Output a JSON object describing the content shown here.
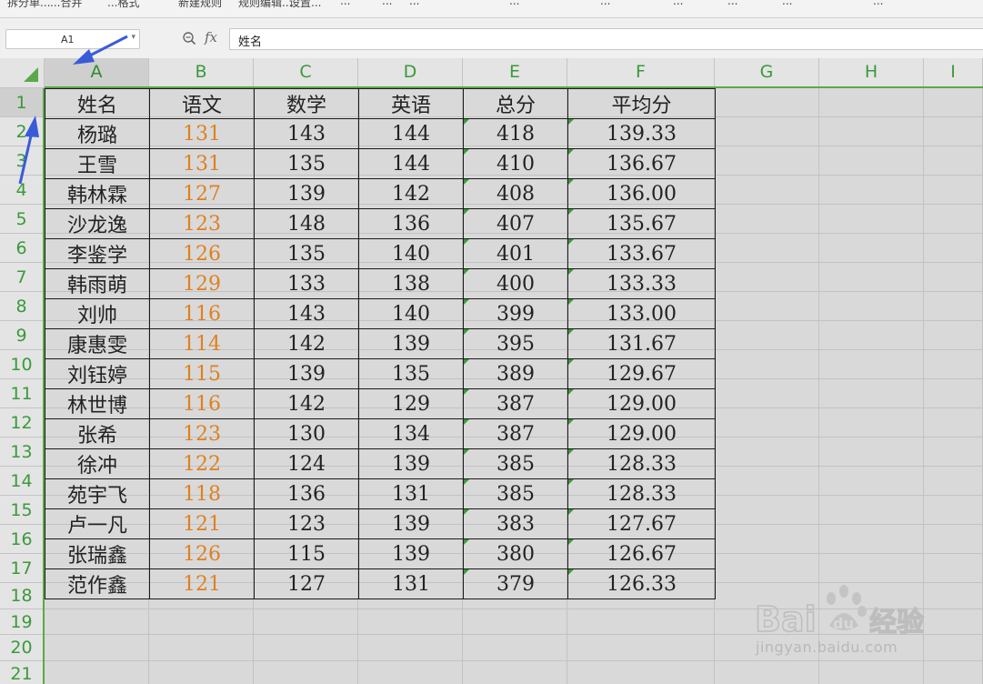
{
  "toolbar": {
    "items": [
      "拆分单...",
      "...合并",
      "...格式",
      "新建规则",
      "规则编辑...",
      "设置...",
      "...",
      "...",
      "...",
      "...",
      "...",
      "...",
      "...",
      "...",
      "..."
    ]
  },
  "formula_bar": {
    "name_box": "A1",
    "fx_label": "fx",
    "formula": "姓名"
  },
  "columns": [
    "A",
    "B",
    "C",
    "D",
    "E",
    "F",
    "G",
    "H",
    "I"
  ],
  "rows": [
    "1",
    "2",
    "3",
    "4",
    "5",
    "6",
    "7",
    "8",
    "9",
    "10",
    "11",
    "12",
    "13",
    "14",
    "15",
    "16",
    "17",
    "18",
    "19",
    "20",
    "21"
  ],
  "table": {
    "header": [
      "姓名",
      "语文",
      "数学",
      "英语",
      "总分",
      "平均分"
    ],
    "rows": [
      [
        "杨璐",
        "131",
        "143",
        "144",
        "418",
        "139.33"
      ],
      [
        "王雪",
        "131",
        "135",
        "144",
        "410",
        "136.67"
      ],
      [
        "韩林霖",
        "127",
        "139",
        "142",
        "408",
        "136.00"
      ],
      [
        "沙龙逸",
        "123",
        "148",
        "136",
        "407",
        "135.67"
      ],
      [
        "李鉴学",
        "126",
        "135",
        "140",
        "401",
        "133.67"
      ],
      [
        "韩雨萌",
        "129",
        "133",
        "138",
        "400",
        "133.33"
      ],
      [
        "刘帅",
        "116",
        "143",
        "140",
        "399",
        "133.00"
      ],
      [
        "康惠雯",
        "114",
        "142",
        "139",
        "395",
        "131.67"
      ],
      [
        "刘钰婷",
        "115",
        "139",
        "135",
        "389",
        "129.67"
      ],
      [
        "林世博",
        "116",
        "142",
        "129",
        "387",
        "129.00"
      ],
      [
        "张希",
        "123",
        "130",
        "134",
        "387",
        "129.00"
      ],
      [
        "徐冲",
        "122",
        "124",
        "139",
        "385",
        "128.33"
      ],
      [
        "苑宇飞",
        "118",
        "136",
        "131",
        "385",
        "128.33"
      ],
      [
        "卢一凡",
        "121",
        "123",
        "139",
        "383",
        "127.67"
      ],
      [
        "张瑞鑫",
        "126",
        "115",
        "139",
        "380",
        "126.67"
      ],
      [
        "范作鑫",
        "121",
        "127",
        "131",
        "379",
        "126.33"
      ]
    ]
  },
  "colors": {
    "header_green": "#3a9a3a",
    "highlight_orange": "#e08020",
    "arrow_blue": "#3a5bd9"
  },
  "watermark": {
    "brand": "Bai",
    "brand_suffix": "du",
    "cn": "经验",
    "url": "jingyan.baidu.com"
  }
}
